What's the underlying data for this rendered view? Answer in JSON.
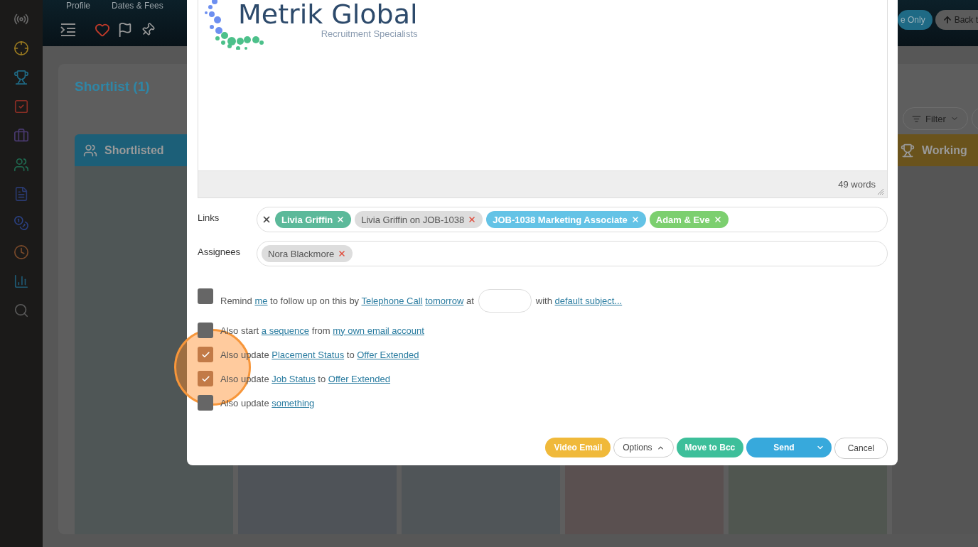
{
  "sidebar": {
    "items": [
      {
        "kind": "antenna",
        "color": "#6a6a6a"
      },
      {
        "kind": "crosshair",
        "color": "#9a7a20"
      },
      {
        "kind": "trophy",
        "color": "#1f6a85"
      },
      {
        "kind": "check",
        "color": "#8a2e25"
      },
      {
        "kind": "briefcase",
        "color": "#4a3a70"
      },
      {
        "kind": "people",
        "color": "#1f6a50"
      },
      {
        "kind": "document",
        "color": "#2a3a70"
      },
      {
        "kind": "coins",
        "color": "#2a4080"
      },
      {
        "kind": "clock",
        "color": "#7a4a2a"
      },
      {
        "kind": "chart",
        "color": "#1f5a75"
      },
      {
        "kind": "search",
        "color": "#5a5a5a"
      }
    ]
  },
  "header": {
    "tabs": [
      {
        "label": "Profile",
        "selected": false
      },
      {
        "label": "Dates & Fees",
        "selected": false
      }
    ],
    "buttons": [
      {
        "label": "e Only",
        "kind": "primary"
      },
      {
        "label": "Back t",
        "kind": "back"
      }
    ]
  },
  "board": {
    "title": "Shortlist (1)",
    "filter": "Filter",
    "columns": [
      {
        "label": "Shortlisted",
        "kind": "people",
        "header": {
          "color": "#1c5f78"
        },
        "body": {
          "color": "#4f5656"
        }
      },
      {
        "body": {
          "color": "#4f5358"
        }
      },
      {
        "body": {
          "color": "#505558"
        }
      },
      {
        "body": {
          "color": "#5a5050"
        }
      },
      {
        "body": {
          "color": "#505650"
        }
      },
      {
        "label": "Working",
        "kind": "trophy",
        "header": {
          "color": "#6a531c"
        },
        "body": {
          "color": "#555555"
        }
      }
    ]
  },
  "modal": {
    "editor": {
      "logo_title": "Metrik Global",
      "logo_subtitle": "Recruitment Specialists",
      "word_count": "49 words"
    },
    "links": {
      "label": "Links",
      "chips": [
        {
          "label": "Livia Griffin",
          "color": "#5cb99a"
        },
        {
          "label": "Livia Griffin on JOB-1038",
          "color": "#dddddd"
        },
        {
          "label": "JOB-1038 Marketing Associate",
          "color": "#64c3e6"
        },
        {
          "label": "Adam & Eve",
          "color": "#7ccf6f"
        }
      ]
    },
    "assignees": {
      "label": "Assignees",
      "chips": [
        {
          "label": "Nora Blackmore",
          "color": "#dddddd"
        }
      ]
    },
    "options": [
      {
        "checked": false,
        "segments": [
          {
            "kind": "sentence",
            "parts": [
              {
                "kind": "text",
                "text": "Remind "
              },
              {
                "kind": "link",
                "text": "me"
              },
              {
                "kind": "text",
                "text": " to follow up on this by "
              },
              {
                "kind": "link",
                "text": "Telephone Call"
              },
              {
                "kind": "link",
                "text": "tomorrow"
              },
              {
                "kind": "text",
                "text": " at"
              }
            ]
          },
          {
            "kind": "time_field"
          },
          {
            "kind": "sentence",
            "parts": [
              {
                "kind": "text",
                "text": "with "
              },
              {
                "kind": "link",
                "text": "default subject..."
              }
            ]
          }
        ]
      },
      {
        "checked": false,
        "segments": [
          {
            "kind": "sentence",
            "parts": [
              {
                "kind": "text",
                "text": "Also start "
              },
              {
                "kind": "link",
                "text": "a sequence"
              },
              {
                "kind": "text",
                "text": " from "
              },
              {
                "kind": "link",
                "text": "my own email account"
              }
            ]
          }
        ]
      },
      {
        "checked": true,
        "segments": [
          {
            "kind": "sentence",
            "parts": [
              {
                "kind": "text",
                "text": "Also update "
              },
              {
                "kind": "link",
                "text": "Placement Status"
              },
              {
                "kind": "text",
                "text": " to "
              },
              {
                "kind": "link",
                "text": "Offer Extended"
              }
            ]
          }
        ]
      },
      {
        "checked": true,
        "segments": [
          {
            "kind": "sentence",
            "parts": [
              {
                "kind": "text",
                "text": "Also update "
              },
              {
                "kind": "link",
                "text": "Job Status"
              },
              {
                "kind": "text",
                "text": " to "
              },
              {
                "kind": "link",
                "text": "Offer Extended"
              }
            ]
          }
        ]
      },
      {
        "checked": false,
        "segments": [
          {
            "kind": "sentence",
            "parts": [
              {
                "kind": "text",
                "text": "Also update "
              },
              {
                "kind": "link",
                "text": "something"
              }
            ]
          }
        ]
      }
    ],
    "buttons": [
      {
        "label": "Video Email",
        "kind": "warning"
      },
      {
        "label": "Options",
        "kind": "menu"
      },
      {
        "label": "Move to Bcc",
        "kind": "success"
      },
      {
        "label": "Send",
        "kind": "split"
      },
      {
        "label": "Cancel",
        "kind": "plain"
      }
    ]
  }
}
